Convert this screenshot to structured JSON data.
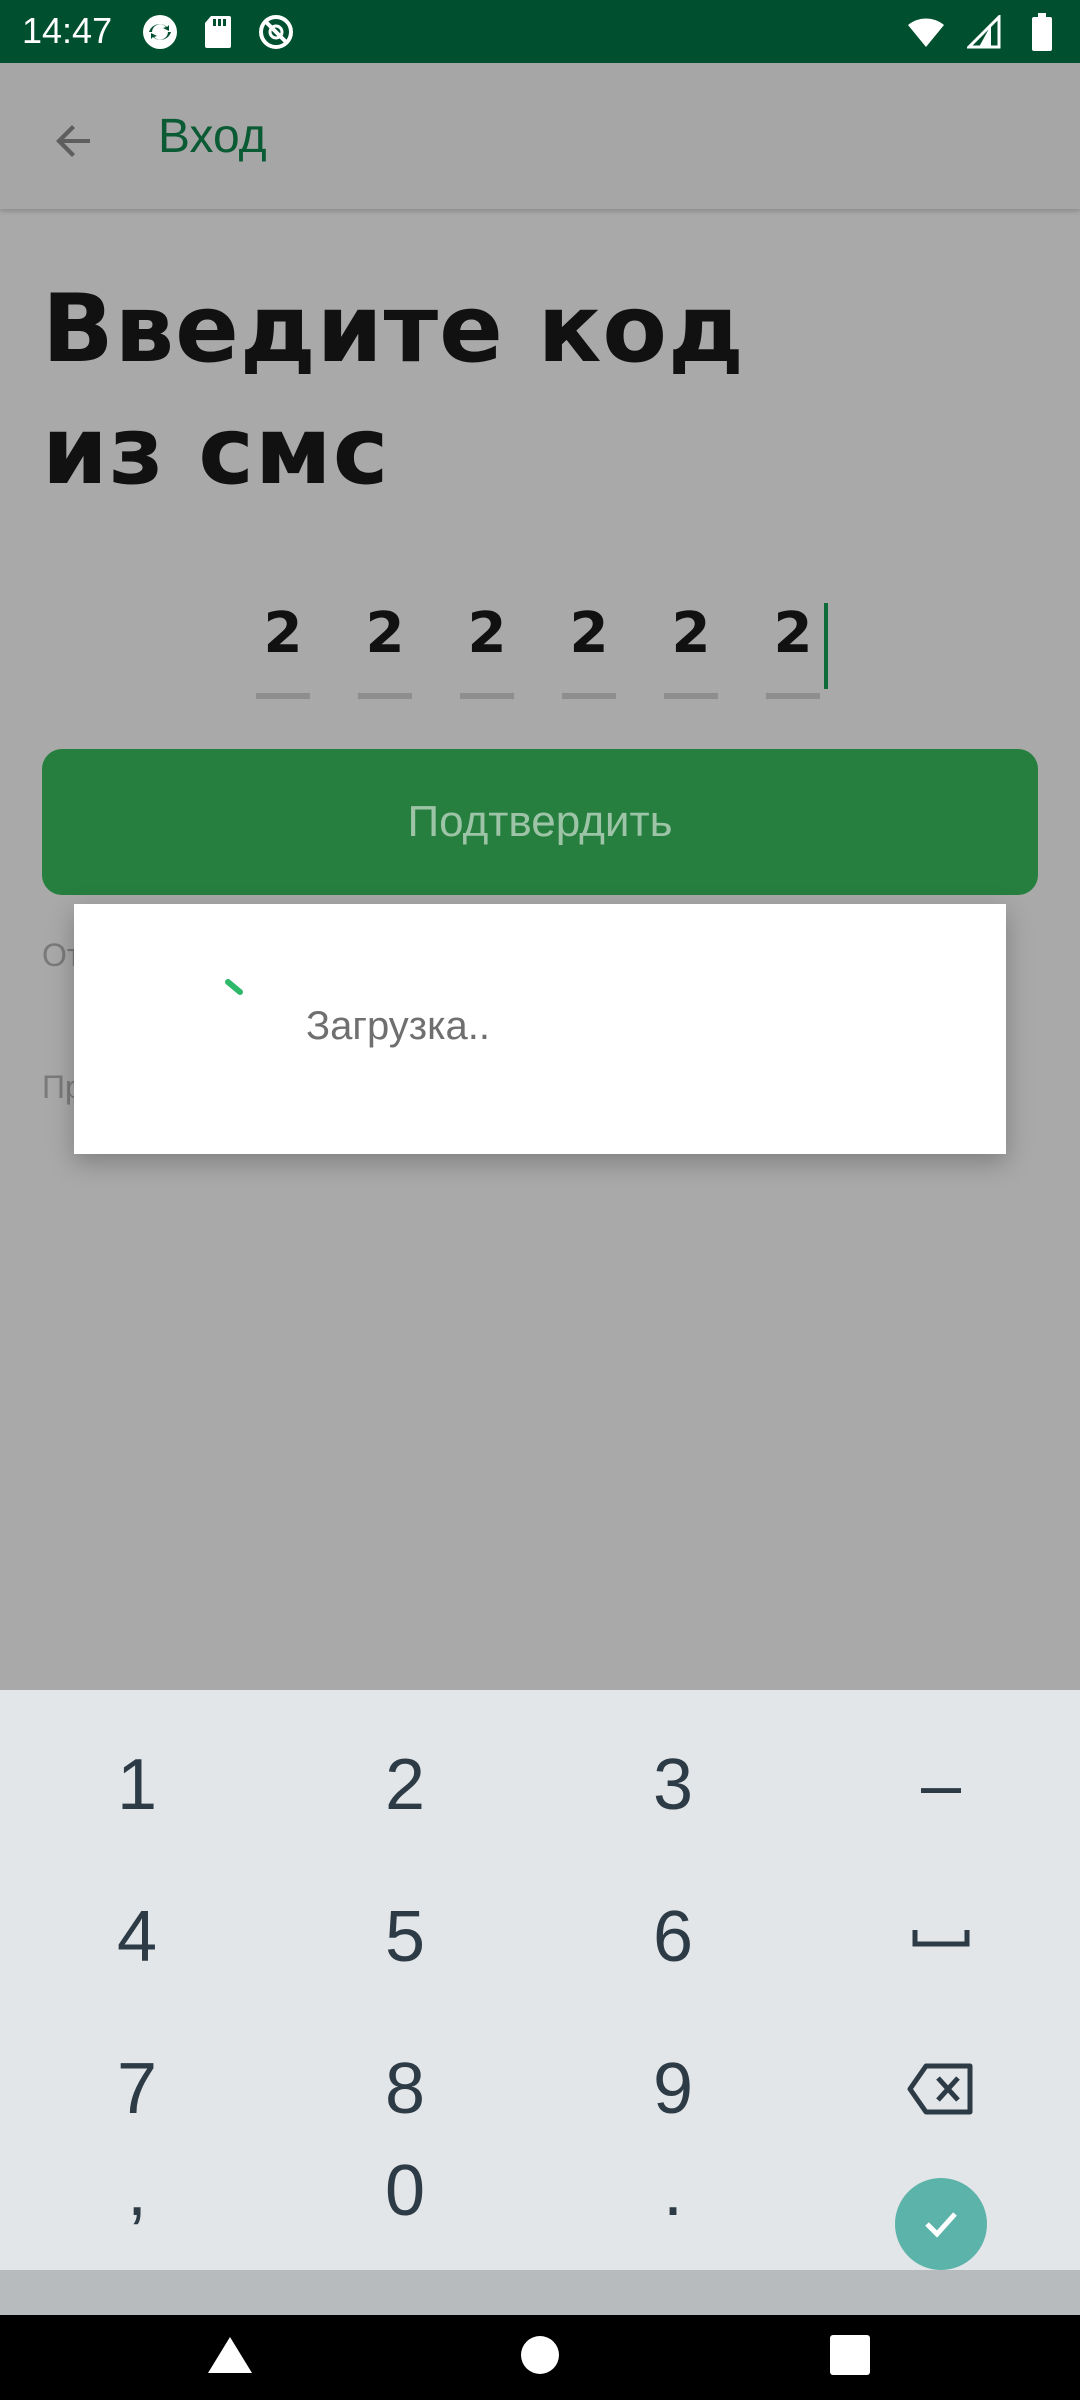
{
  "status_bar": {
    "time": "14:47"
  },
  "app_bar": {
    "title": "Вход"
  },
  "main": {
    "heading_line1": "Введите код",
    "heading_line2": "из смс",
    "code_digits": [
      "2",
      "2",
      "2",
      "2",
      "2",
      "2"
    ],
    "confirm_label": "Подтвердить",
    "partial_text_1": "От",
    "partial_text_2": "Пр"
  },
  "dialog": {
    "loading_label": "Загрузка.."
  },
  "keyboard": {
    "row1": [
      "1",
      "2",
      "3",
      "–"
    ],
    "row2": [
      "4",
      "5",
      "6",
      ""
    ],
    "row3": [
      "7",
      "8",
      "9",
      ""
    ],
    "row4": [
      ",",
      "0",
      "."
    ]
  },
  "colors": {
    "status_bar": "#00502f",
    "accent_green": "#267f3f",
    "spinner_green": "#2db86a",
    "ok_key": "#5cb3aa"
  }
}
